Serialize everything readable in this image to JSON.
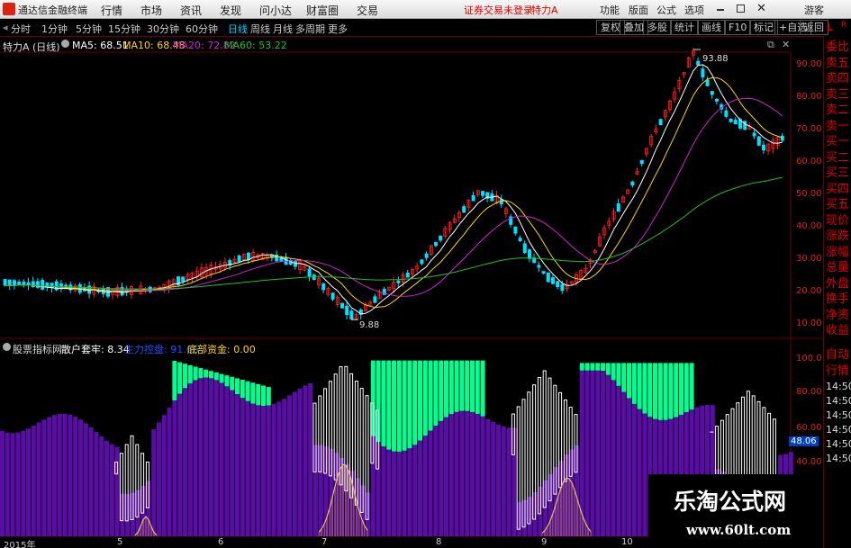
{
  "app": {
    "title": "通达信金融终端",
    "menus": [
      "行情",
      "市场",
      "资讯",
      "发现",
      "问小达",
      "财富圈",
      "交易"
    ],
    "warning": "证券交易未登录",
    "stock_title": "特力A",
    "right_menus": [
      "功能",
      "版面",
      "公式",
      "选项"
    ],
    "guest": "游客"
  },
  "timeframes": [
    "分时",
    "1分钟",
    "5分钟",
    "15分钟",
    "30分钟",
    "60分钟",
    "日线",
    "周线",
    "月线",
    "多周期",
    "更多"
  ],
  "active_timeframe": "日线",
  "toolbar": [
    "复权",
    "叠加",
    "多股",
    "统计",
    "画线",
    "F10",
    "标记",
    "+自选",
    "返回"
  ],
  "main_header": {
    "stock": "特力A",
    "period": "(日线)",
    "ma5": "MA5: 68.51",
    "ma10": "MA10: 68.48",
    "ma20": "MA20: 72.82",
    "ma60": "MA60: 53.22"
  },
  "price_axis": [
    "90.00",
    "80.00",
    "70.00",
    "60.00",
    "50.00",
    "40.00",
    "30.00",
    "20.00",
    "10.00"
  ],
  "annotations": {
    "high": "93.88",
    "low": "9.88"
  },
  "indicator_header": {
    "name": "股票指标网",
    "retail": "散户套牢: 8.34",
    "main_control": "主力控盘: 91.66",
    "bottom_fund": "底部资金: 0.00"
  },
  "indicator_axis": [
    "100.0",
    "80.00",
    "60.00",
    "40.00"
  ],
  "indicator_value": "48.06",
  "right_panel": {
    "top": [
      "委比",
      "卖五",
      "卖四",
      "卖三",
      "卖二",
      "卖一",
      "买一",
      "买二",
      "买三",
      "买四",
      "买五",
      "现价",
      "涨跌",
      "涨幅",
      "总量",
      "外盘",
      "换手",
      "净资",
      "收益"
    ],
    "bottom": [
      "自动",
      "行情",
      "14:50",
      "14:50",
      "14:50",
      "14:50",
      "14:50",
      "14:50"
    ]
  },
  "months": [
    "2015年",
    "5",
    "6",
    "7",
    "8",
    "9",
    "10"
  ],
  "watermark": {
    "title": "乐淘公式网",
    "url": "www.60lt.com"
  },
  "colors": {
    "up": "#ff2020",
    "down": "#00e0ff",
    "ma5": "#ffffff",
    "ma10": "#ffd700",
    "ma20": "#d020d0",
    "ma60": "#20c020",
    "green_bar": "#00ff90",
    "purple_bar": "#5a0da6"
  }
}
